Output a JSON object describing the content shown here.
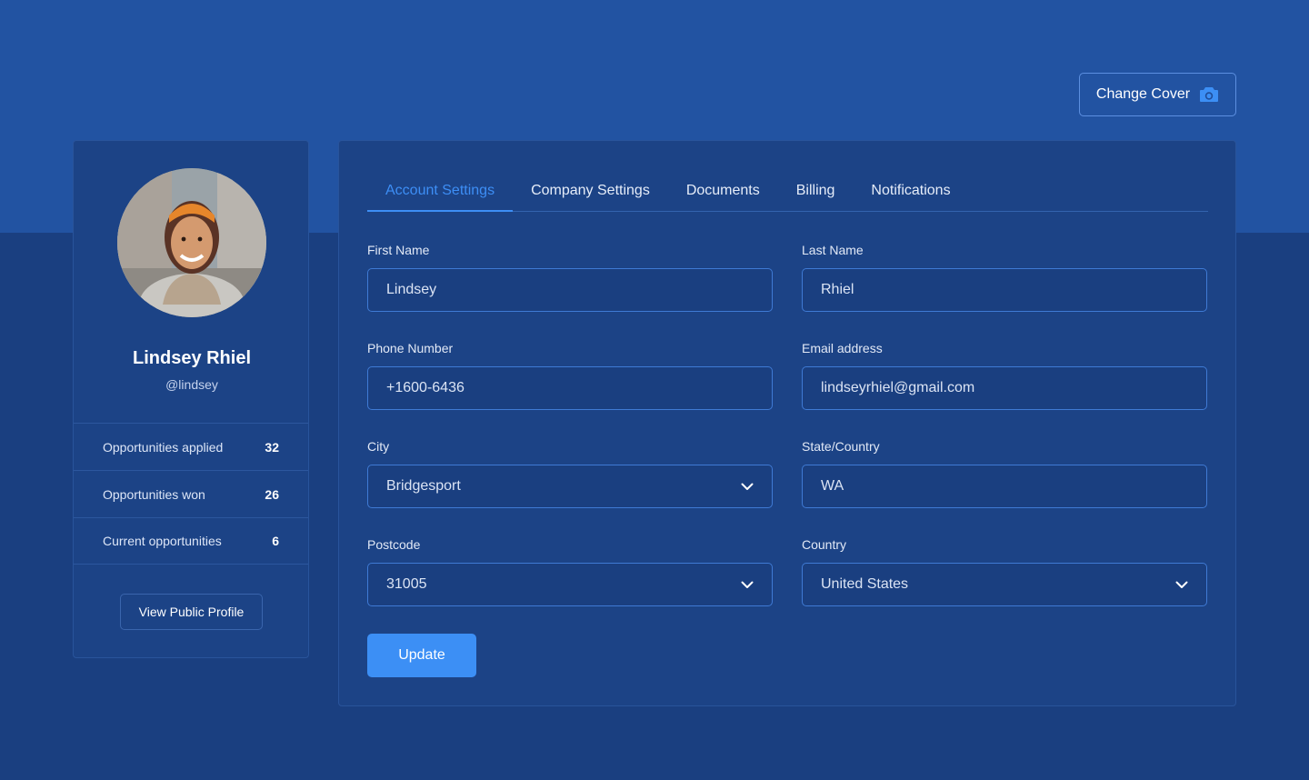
{
  "header": {
    "change_cover_label": "Change Cover"
  },
  "profile": {
    "name": "Lindsey Rhiel",
    "handle": "@lindsey",
    "stats": [
      {
        "label": "Opportunities applied",
        "value": "32"
      },
      {
        "label": "Opportunities won",
        "value": "26"
      },
      {
        "label": "Current opportunities",
        "value": "6"
      }
    ],
    "view_profile_label": "View Public Profile"
  },
  "tabs": [
    {
      "label": "Account Settings",
      "active": true
    },
    {
      "label": "Company Settings",
      "active": false
    },
    {
      "label": "Documents",
      "active": false
    },
    {
      "label": "Billing",
      "active": false
    },
    {
      "label": "Notifications",
      "active": false
    }
  ],
  "form": {
    "first_name": {
      "label": "First Name",
      "value": "Lindsey"
    },
    "last_name": {
      "label": "Last Name",
      "value": "Rhiel"
    },
    "phone": {
      "label": "Phone Number",
      "value": "+1600-6436"
    },
    "email": {
      "label": "Email address",
      "value": "lindseyrhiel@gmail.com"
    },
    "city": {
      "label": "City",
      "value": "Bridgesport"
    },
    "state": {
      "label": "State/Country",
      "value": "WA"
    },
    "postcode": {
      "label": "Postcode",
      "value": "31005"
    },
    "country": {
      "label": "Country",
      "value": "United States"
    },
    "update_label": "Update"
  },
  "colors": {
    "accent": "#3c8ff5",
    "cover": "#2253a2",
    "background": "#1a3f80",
    "card": "#1c4386"
  }
}
